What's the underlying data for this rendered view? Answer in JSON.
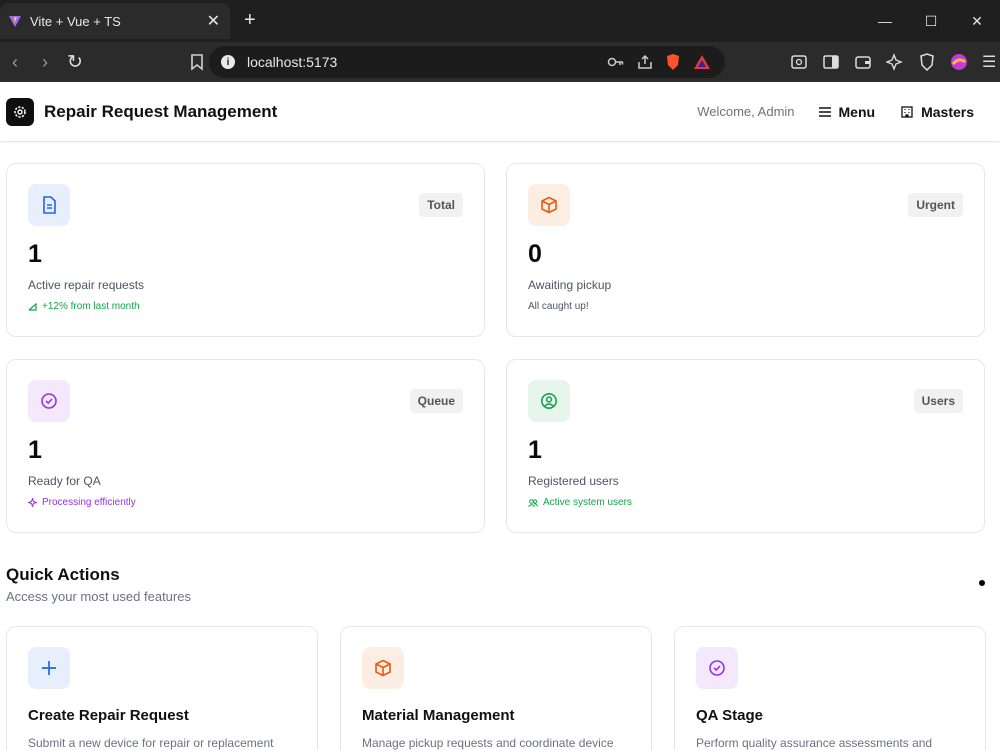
{
  "browser": {
    "tab_title": "Vite + Vue + TS",
    "url": "localhost:5173"
  },
  "header": {
    "app_title": "Repair Request Management",
    "welcome": "Welcome, Admin",
    "menu_label": "Menu",
    "masters_label": "Masters"
  },
  "stats": [
    {
      "badge": "Total",
      "value": "1",
      "label": "Active repair requests",
      "sub": "+12% from last month",
      "color": "#16a34a"
    },
    {
      "badge": "Urgent",
      "value": "0",
      "label": "Awaiting pickup",
      "sub": "All caught up!",
      "color": "#4b5563"
    },
    {
      "badge": "Queue",
      "value": "1",
      "label": "Ready for QA",
      "sub": "Processing efficiently",
      "color": "#9333ea"
    },
    {
      "badge": "Users",
      "value": "1",
      "label": "Registered users",
      "sub": "Active system users",
      "color": "#16a34a"
    }
  ],
  "quick_actions": {
    "title": "Quick Actions",
    "subtitle": "Access your most used features",
    "items": [
      {
        "title": "Create Repair Request",
        "desc": "Submit a new device for repair or replacement"
      },
      {
        "title": "Material Management",
        "desc": "Manage pickup requests and coordinate device"
      },
      {
        "title": "QA Stage",
        "desc": "Perform quality assurance assessments and"
      }
    ]
  },
  "colors": {
    "blue": "#2563eb",
    "orange": "#ea580c",
    "purple": "#9333ea",
    "green": "#16a34a"
  }
}
